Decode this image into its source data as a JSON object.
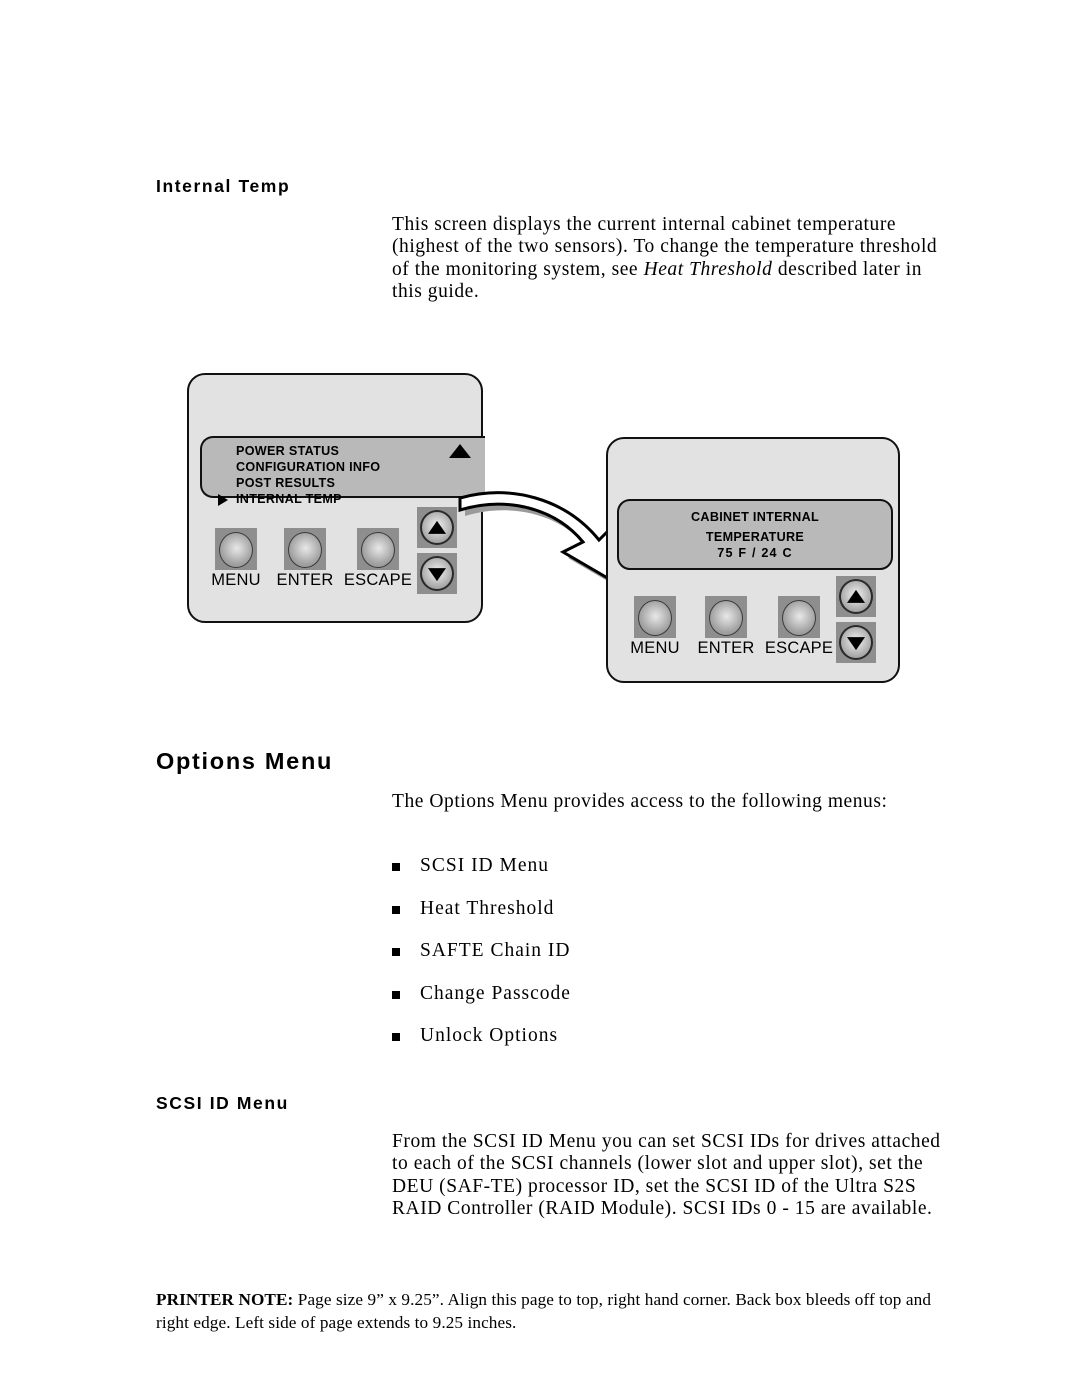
{
  "page": {
    "background_color": "#ffffff",
    "text_color": "#000000"
  },
  "sections": {
    "internal_temp": {
      "heading": "Internal Temp",
      "paragraph_part1": "This screen displays the current internal cabinet temperature (highest of the two sensors). To change the temperature threshold of the monitoring system, see ",
      "paragraph_italic": "Heat Threshold",
      "paragraph_part2": " described later in this guide."
    },
    "options_menu": {
      "heading": "Options Menu",
      "paragraph": "The Options Menu provides access to the following menus:",
      "bullets": [
        "SCSI ID Menu",
        "Heat Threshold",
        "SAFTE Chain ID",
        "Change Passcode",
        "Unlock Options"
      ]
    },
    "scsi_id_menu": {
      "heading": "SCSI ID Menu",
      "paragraph": "From the SCSI ID Menu you can set SCSI IDs for drives attached to each of the SCSI channels (lower slot and upper slot), set the DEU (SAF-TE) processor ID, set the SCSI ID of the Ultra S2S RAID Controller (RAID Module). SCSI IDs 0 - 15 are available."
    }
  },
  "diagram": {
    "panel_menu": {
      "label": "Control panel showing Internal Temp selected",
      "body_color": "#e2e2e2",
      "lcd_color": "#b9b9b9",
      "lcd_lines": [
        "POWER STATUS",
        "CONFIGURATION INFO",
        "POST RESULTS",
        "INTERNAL TEMP"
      ],
      "selected_index": 3,
      "scroll_up_indicator": "scroll-up-triangle",
      "cursor_indicator": "right-pointing-triangle",
      "buttons": [
        {
          "label": "MENU"
        },
        {
          "label": "ENTER"
        },
        {
          "label": "ESCAPE"
        }
      ],
      "arrow_buttons": [
        {
          "name": "up-arrow-button"
        },
        {
          "name": "down-arrow-button"
        }
      ]
    },
    "panel_temp": {
      "label": "Control panel showing Cabinet Internal Temperature",
      "body_color": "#e2e2e2",
      "lcd_color": "#b9b9b9",
      "lcd_lines": [
        "CABINET INTERNAL",
        "TEMPERATURE",
        "75 F   /   24 C"
      ],
      "buttons": [
        {
          "label": "MENU"
        },
        {
          "label": "ENTER"
        },
        {
          "label": "ESCAPE"
        }
      ],
      "arrow_buttons": [
        {
          "name": "up-arrow-button"
        },
        {
          "name": "down-arrow-button"
        }
      ]
    },
    "connector": {
      "name": "curved-arrow",
      "fill": "#ffffff",
      "stroke": "#000000",
      "shadow": "#9a9a9a"
    }
  },
  "footer": {
    "label": "PRINTER NOTE:",
    "text": " Page size 9” x 9.25”.  Align this page to top, right hand corner. Back box bleeds off top and right edge. Left side of page extends to 9.25 inches."
  }
}
